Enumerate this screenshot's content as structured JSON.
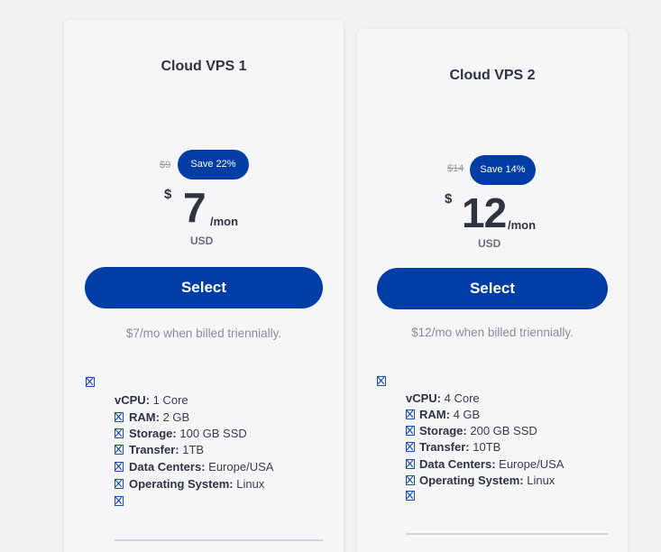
{
  "plans": [
    {
      "title": "Cloud VPS 1",
      "old_price": "$9",
      "save_label": "Save 22%",
      "currency_symbol": "$",
      "price": "7",
      "period": "/mon",
      "currency_code": "USD",
      "select_label": "Select",
      "billing_note": "$7/mo when billed triennially.",
      "specs": [
        {
          "key": "vCPU:",
          "value": "1 Core"
        },
        {
          "key": "RAM:",
          "value": "2 GB"
        },
        {
          "key": "Storage:",
          "value": "100 GB SSD"
        },
        {
          "key": "Transfer:",
          "value": "1TB"
        },
        {
          "key": "Data Centers:",
          "value": "Europe/USA"
        },
        {
          "key": "Operating System:",
          "value": "Linux"
        }
      ]
    },
    {
      "title": "Cloud VPS 2",
      "old_price": "$14",
      "save_label": "Save 14%",
      "currency_symbol": "$",
      "price": "12",
      "period": "/mon",
      "currency_code": "USD",
      "select_label": "Select",
      "billing_note": "$12/mo when billed triennially.",
      "specs": [
        {
          "key": "vCPU:",
          "value": "4 Core"
        },
        {
          "key": "RAM:",
          "value": "4 GB"
        },
        {
          "key": "Storage:",
          "value": "200 GB SSD"
        },
        {
          "key": "Transfer:",
          "value": "10TB"
        },
        {
          "key": "Data Centers:",
          "value": "Europe/USA"
        },
        {
          "key": "Operating System:",
          "value": "Linux"
        }
      ]
    }
  ],
  "icons": {
    "spec": "broken-image-icon"
  },
  "colors": {
    "accent": "#003da5",
    "background": "#f2f2f4",
    "card": "#f6f6f8"
  }
}
